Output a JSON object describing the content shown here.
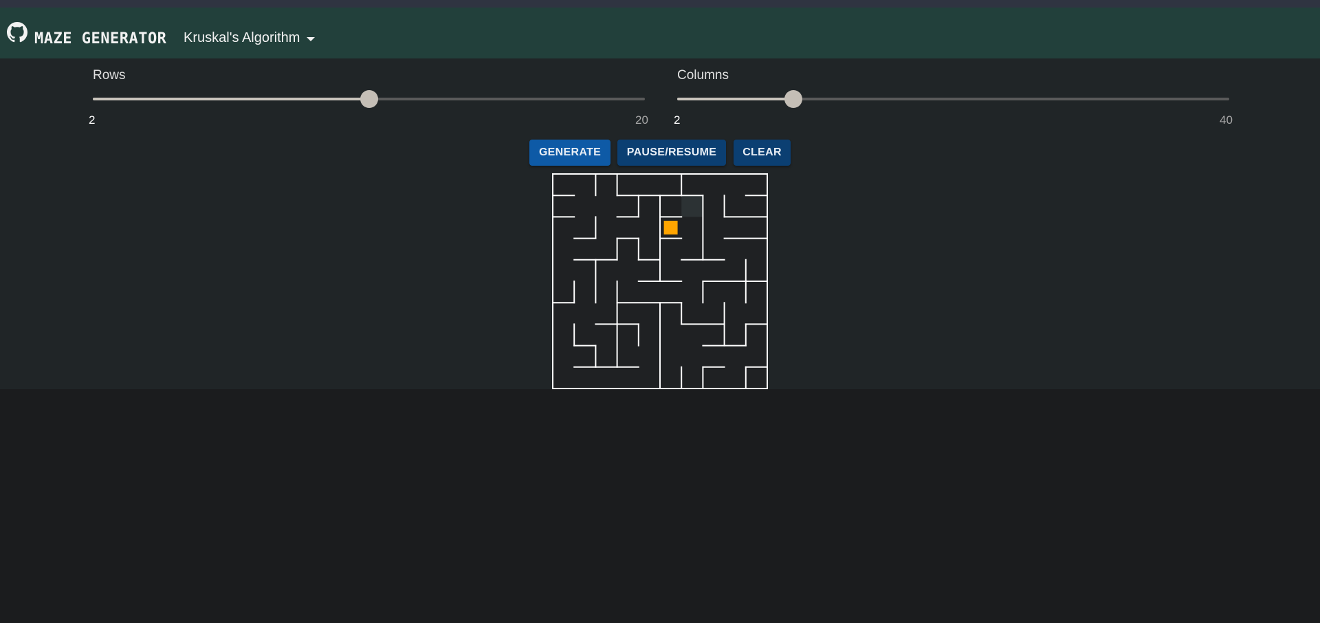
{
  "navbar": {
    "github_icon": "github-icon",
    "brand": "MAZE GENERATOR",
    "algorithm_selected": "Kruskal's Algorithm"
  },
  "controls": {
    "rows": {
      "label": "Rows",
      "min": "2",
      "max": "20",
      "value": 11
    },
    "columns": {
      "label": "Columns",
      "min": "2",
      "max": "40",
      "value": 10
    }
  },
  "buttons": {
    "generate": "GENERATE",
    "pause_resume": "PAUSE/RESUME",
    "clear": "CLEAR"
  },
  "maze": {
    "grid_rows": 10,
    "grid_cols": 10,
    "current_cell": [
      2,
      5
    ],
    "colors": {
      "background": "#1f2123",
      "walls": "#ffffff",
      "current": "#ffa500",
      "highlight": "#2c3234"
    }
  },
  "colors": {
    "navbar": "#22403b",
    "panel": "#202527",
    "page": "#1b1c1e",
    "primary_button": "#0e5aa6",
    "secondary_button": "#0b3f72"
  }
}
